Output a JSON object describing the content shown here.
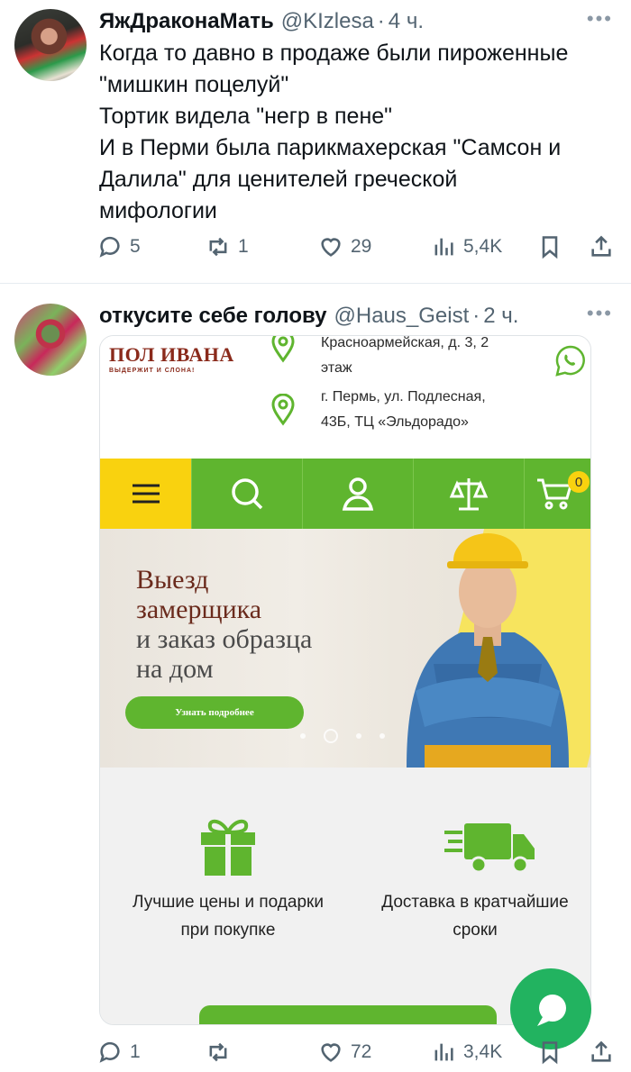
{
  "tweet1": {
    "author_name": "ЯжДраконаМать",
    "handle": "@KIzlesa",
    "time": "4 ч.",
    "text_lines": [
      "Когда то давно в продаже были пироженные",
      "\"мишкин поцелуй\"",
      "Тортик видела \"негр в пене\"",
      "И в Перми была парикмахерская \"Самсон и",
      "Далила\" для ценителей греческой",
      "мифологии"
    ],
    "replies": "5",
    "retweets": "1",
    "likes": "29",
    "views": "5,4K"
  },
  "tweet2": {
    "author_name": "откусите себе голову",
    "handle": "@Haus_Geist",
    "time": "2 ч.",
    "replies": "1",
    "retweets": "",
    "likes": "72",
    "views": "3,4K",
    "media": {
      "logo_title": "ПОЛ ИВАНА",
      "logo_subtitle": "ВЫДЕРЖИТ И СЛОНА!",
      "address1_line1": "Красноармейская, д. 3, 2",
      "address1_line2": "этаж",
      "address2_line1": "г. Пермь, ул. Подлесная,",
      "address2_line2": "43Б, ТЦ «Эльдорадо»",
      "cart_count": "0",
      "banner_title_line1": "Выезд",
      "banner_title_line2": "замерщика",
      "banner_sub_line1": "и заказ образца",
      "banner_sub_line2": "на дом",
      "banner_button": "Узнать подробнее",
      "feature1_line1": "Лучшие цены и подарки",
      "feature1_line2": "при покупке",
      "feature2_line1": "Доставка в кратчайшие",
      "feature2_line2": "сроки",
      "colors": {
        "brand_green": "#5fb52f",
        "brand_yellow": "#f9d20f",
        "logo_red": "#8a2a1b"
      }
    }
  },
  "more_icon": "…",
  "separator": "·"
}
